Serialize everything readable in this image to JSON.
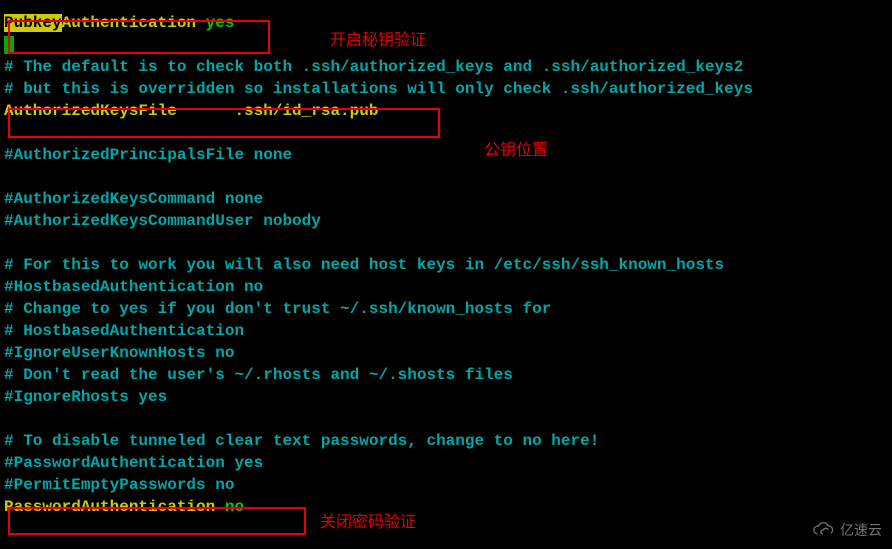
{
  "config": {
    "pubkey_key": "Pubkey",
    "pubkey_auth": "Authentication ",
    "pubkey_val": "yes",
    "akf_key": "AuthorizedKeysFile",
    "akf_gap": "      ",
    "akf_val": ".ssh/id_rsa.pub",
    "pa_key": "PasswordAuthentication ",
    "pa_val": "no"
  },
  "lines": {
    "c1": "# The default is to check both .ssh/authorized_keys and .ssh/authorized_keys2",
    "c2": "# but this is overridden so installations will only check .ssh/authorized_keys",
    "c3": "#AuthorizedPrincipalsFile none",
    "c4": "#AuthorizedKeysCommand none",
    "c5": "#AuthorizedKeysCommandUser nobody",
    "c6": "# For this to work you will also need host keys in /etc/ssh/ssh_known_hosts",
    "c7": "#HostbasedAuthentication no",
    "c8": "# Change to yes if you don't trust ~/.ssh/known_hosts for",
    "c9": "# HostbasedAuthentication",
    "c10": "#IgnoreUserKnownHosts no",
    "c11": "# Don't read the user's ~/.rhosts and ~/.shosts files",
    "c12": "#IgnoreRhosts yes",
    "c13": "# To disable tunneled clear text passwords, change to no here!",
    "c14": "#PasswordAuthentication yes",
    "c15": "#PermitEmptyPasswords no"
  },
  "annotations": {
    "a1": "开启秘钥验证",
    "a2": "公钥位置",
    "a3": "关闭密码验证"
  },
  "watermark": "亿速云"
}
